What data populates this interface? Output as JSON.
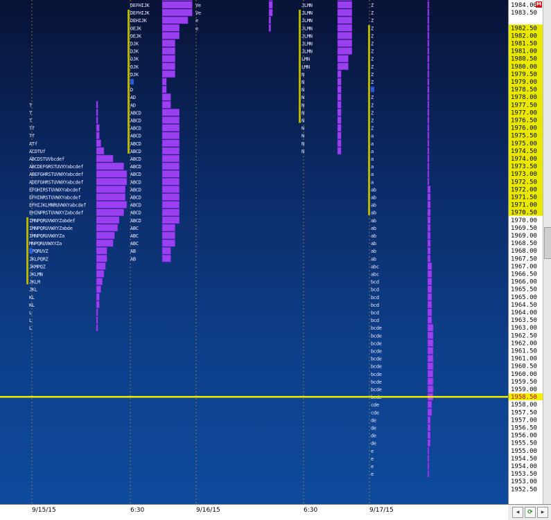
{
  "chart_data": {
    "type": "market-profile",
    "price_axis": {
      "top": 1984.0,
      "labels": [
        "1984.00",
        "1983.50",
        "1982.50",
        "1982.00",
        "1981.50",
        "1981.00",
        "1980.50",
        "1980.00",
        "1979.50",
        "1979.00",
        "1978.50",
        "1978.00",
        "1977.50",
        "1977.00",
        "1976.50",
        "1976.00",
        "1975.50",
        "1975.00",
        "1974.50",
        "1974.00",
        "1973.50",
        "1973.00",
        "1972.50",
        "1972.00",
        "1971.50",
        "1971.00",
        "1970.50",
        "1970.00",
        "1969.50",
        "1969.00",
        "1968.50",
        "1968.00",
        "1967.50",
        "1967.00",
        "1966.50",
        "1966.00",
        "1965.50",
        "1965.00",
        "1964.50",
        "1964.00",
        "1963.50",
        "1963.00",
        "1962.50",
        "1962.00",
        "1961.50",
        "1961.00",
        "1960.50",
        "1960.00",
        "1959.50",
        "1959.00",
        "1958.50",
        "1958.00",
        "1957.50",
        "1957.00",
        "1956.50",
        "1956.00",
        "1955.50",
        "1955.00",
        "1954.50",
        "1954.00",
        "1953.50",
        "1953.00",
        "1952.50"
      ],
      "highlight_range": [
        1970.5,
        1982.5
      ],
      "last_price": "1958.50",
      "corner_marker": "M"
    },
    "last_price_line": 1958.5,
    "x_labels": [
      "9/15/15",
      "6:30",
      "9/16/15",
      "6:30",
      "9/17/15"
    ],
    "profiles": [
      {
        "session": "9/15/15 day",
        "low": 1963.0,
        "high": 1973.0,
        "va_low": 1966.0,
        "va_high": 1970.0,
        "poc": 1968.0,
        "letters": [
          "L",
          "L",
          "L",
          "KL",
          "KL",
          "JKL",
          "JKLM",
          "JKLMN",
          "JKMPQZ",
          "JKLPQRZ",
          "MPQRUVZ",
          "MNPQRUVWXYZa",
          "IMNPQRUVWXYZa",
          "IMNPQRUVWXYZabde",
          "IMNPQRUVWXYZabdef",
          "EHINPRSTUVWXYZabcdef",
          "EFHIJKLMNRUVWXYabcdef",
          "EFHINRSTUVWXYabcdef",
          "EFGHIRSTUVWXYabcdef",
          "ADEFGHRSTUVWXYabcdef",
          "ABEFGHRSTUVWXYabcdef",
          "ABCDEFGRSTUVXYabcdef",
          "ABCDSTUVbcdef",
          "ACDTUf",
          "ATf",
          "Tf",
          "Tf",
          "T",
          "T",
          "T"
        ],
        "tpo_counts": [
          1,
          1,
          1,
          2,
          2,
          3,
          4,
          5,
          6,
          7,
          7,
          11,
          12,
          14,
          15,
          18,
          20,
          19,
          19,
          20,
          20,
          18,
          11,
          5,
          3,
          2,
          2,
          1,
          1,
          1
        ]
      },
      {
        "session": "9/15/15 overnight",
        "low": 1967.5,
        "high": 1984.0,
        "va_low": 1974.5,
        "va_high": 1983.5,
        "poc": 1979.0,
        "letters": [
          "AB",
          "AB",
          "ABC",
          "ABC",
          "ABC",
          "ABCD",
          "ABCD",
          "ABCD",
          "ABCD",
          "ABCD",
          "ABCD",
          "ABCD",
          "ABCD",
          "ABCD",
          "ABCD",
          "ABCD",
          "ABCD",
          "ABCD",
          "ABCD",
          "ABCD",
          "AD",
          "AD",
          "D",
          "D",
          "DJK",
          "DJK",
          "DJK",
          "DJK",
          "DJK",
          "DEJK",
          "DEJK",
          "DEHIJK",
          "DEFHIJK",
          "DEFHIJK",
          "DEFHIJK",
          "DEFGHIJK",
          "DEFHIJK",
          "DFGHIJK",
          "DFGHIJK",
          "FGHIJK",
          "FGHIJK",
          "FGHIJKL",
          "GHKL",
          "GHKL",
          "GHKLN",
          "GHLMN",
          "GKLMN",
          "GLMN"
        ],
        "tpo_counts": [
          2,
          2,
          3,
          3,
          3,
          4,
          4,
          4,
          4,
          4,
          4,
          4,
          4,
          4,
          4,
          4,
          4,
          4,
          4,
          4,
          2,
          2,
          1,
          1,
          3,
          3,
          3,
          3,
          3,
          4,
          4,
          6,
          7,
          7,
          7,
          8,
          7,
          7,
          7,
          6,
          6,
          7,
          4,
          4,
          5,
          5,
          5,
          4
        ]
      },
      {
        "session": "9/16/15 day",
        "low": 1982.5,
        "high": 1984.0,
        "letters": [
          "e",
          "e",
          "Ve",
          "Ve",
          "Ye",
          "YYce",
          "YYce",
          "UVYXcde",
          "UVXYZcdef",
          "HTUVWXYZcdef",
          "HTUVWXYZacdef",
          "GHIJSTUVWXYZac"
        ],
        "tpo_counts": [
          1,
          1,
          2,
          2,
          2,
          4,
          4,
          7,
          9,
          12,
          13,
          14
        ]
      },
      {
        "session": "9/16/15 overnight",
        "low": 1974.5,
        "high": 1984.0,
        "va_low": 1976.5,
        "va_high": 1983.5,
        "letters": [
          "N",
          "N",
          "N",
          "N",
          "N",
          "N",
          "N",
          "N",
          "N",
          "N",
          "N",
          "LMN",
          "LMN",
          "JLMN",
          "JLMN",
          "JLMN",
          "JLMN",
          "JLMN",
          "JLMN",
          "JLMN",
          "JLMN",
          "JLMN",
          "AJLMN",
          "AJLMN",
          "AJLM",
          "AJLMN",
          "ABCJLM",
          "ABCJLM",
          "ABCJLM",
          "ABCJLM",
          "ABCJLM"
        ],
        "tpo_counts": [
          1,
          1,
          1,
          1,
          1,
          1,
          1,
          1,
          1,
          1,
          1,
          3,
          3,
          4,
          4,
          4,
          4,
          4,
          4,
          4,
          4,
          4,
          5,
          5,
          4,
          5,
          6,
          6,
          6,
          6,
          6
        ]
      },
      {
        "session": "9/17/15",
        "low": 1953.5,
        "high": 1983.5,
        "va_low": 1970.5,
        "va_high": 1982.5,
        "poc": 1978.5,
        "letters": [
          "e",
          "e",
          "e",
          "e",
          "de",
          "de",
          "de",
          "de",
          "cde",
          "cde",
          "bcde",
          "bcde",
          "bcde",
          "bcde",
          "bcde",
          "bcde",
          "bcde",
          "bcde",
          "bcde",
          "bcde",
          "bcd",
          "bcd",
          "bcd",
          "bcd",
          "bcd",
          "bcd",
          "abc",
          "abc",
          "ab",
          "ab",
          "ab",
          "ab",
          "ab",
          "ab",
          "ab",
          "ab",
          "ab",
          "ab",
          "a",
          "a",
          "a",
          "a",
          "a",
          "a",
          "a",
          "Z",
          "Z",
          "Z",
          "Z",
          "Z",
          "Z",
          "Z",
          "Z",
          "Z",
          "Z",
          "Z",
          "Z",
          "Z",
          "Z",
          "Z",
          "Z",
          "Z",
          "Z",
          "Z",
          "Z",
          "Z",
          "YZ",
          "YZ",
          "YZ",
          "YZ",
          "YZ",
          "YZ",
          "EYZ",
          "EYZ",
          "EXYZ",
          "EXYZ",
          "EFXYZ",
          "EFPWXY",
          "EFPWXY",
          "AEFPXY",
          "AEFGHWXY",
          "ACDEFGHWXY",
          "ACDEFGHWXY",
          "ABCDEFGHWXY",
          "ABCDEFGHIPQTUVWXY",
          "BCDEFGHIPQRSTUVWXY",
          "BCDEFGHIJPQRSTUVWXY",
          "BCDHIJKLMNOPQRSTUVWXY",
          "BCDHIJKLPQRSTUVW",
          "BHIJKLMNOPQRSTUVW",
          "JKLMNOPQRSTUVW",
          "INPQRSTUVW",
          "JKLMNRSTUVW",
          "JKLMNRSTUVW",
          "JKLMNRSTUVW",
          "JKLMNRSUV",
          "JKLMNRSUV",
          "KRSV",
          "KRS",
          "R",
          "R"
        ],
        "tpo_counts": [
          1,
          1,
          1,
          1,
          2,
          2,
          2,
          2,
          3,
          3,
          4,
          4,
          4,
          4,
          4,
          4,
          4,
          4,
          4,
          4,
          3,
          3,
          3,
          3,
          3,
          3,
          3,
          3,
          2,
          2,
          2,
          2,
          2,
          2,
          2,
          2,
          2,
          2,
          1,
          1,
          1,
          1,
          1,
          1,
          1,
          1,
          1,
          1,
          1,
          1,
          1,
          1,
          1,
          1,
          1,
          1,
          1,
          1,
          1,
          1,
          1,
          1,
          1,
          1,
          1,
          1,
          2,
          2,
          2,
          2,
          2,
          2,
          3,
          3,
          4,
          4,
          5,
          6,
          6,
          6,
          8,
          10,
          10,
          11,
          17,
          18,
          19,
          21,
          16,
          17,
          14,
          10,
          11,
          11,
          11,
          9,
          9,
          4,
          3,
          1,
          1
        ]
      }
    ]
  },
  "scrollbar": {
    "refresh_glyph": "⟳"
  }
}
